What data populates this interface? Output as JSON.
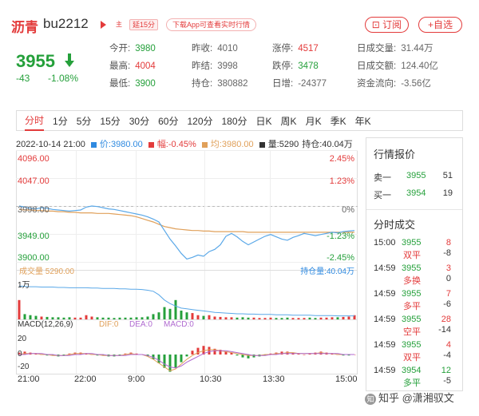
{
  "header": {
    "name": "沥青",
    "code": "bu2212",
    "tag_main": "主",
    "tag_delay": "延15分",
    "app_tag": "下载App可查看实时行情",
    "subscribe_label": "⊡ 订阅",
    "watch_label": "+自选"
  },
  "price": {
    "last": "3955",
    "change": "-43",
    "change_pct": "-1.08%",
    "direction": "down"
  },
  "quote": [
    {
      "k": "今开:",
      "v": "3980",
      "c": "green"
    },
    {
      "k": "昨收:",
      "v": "4010",
      "c": "gray"
    },
    {
      "k": "涨停:",
      "v": "4517",
      "c": "red"
    },
    {
      "k": "日成交量:",
      "v": "31.44万",
      "c": "gray"
    },
    {
      "k": "最高:",
      "v": "4004",
      "c": "red"
    },
    {
      "k": "昨结:",
      "v": "3998",
      "c": "gray"
    },
    {
      "k": "跌停:",
      "v": "3478",
      "c": "green"
    },
    {
      "k": "日成交额:",
      "v": "124.40亿",
      "c": "gray"
    },
    {
      "k": "最低:",
      "v": "3900",
      "c": "green"
    },
    {
      "k": "持仓:",
      "v": "380882",
      "c": "gray"
    },
    {
      "k": "日增:",
      "v": "-24377",
      "c": "gray"
    },
    {
      "k": "资金流向:",
      "v": "-3.56亿",
      "c": "gray"
    }
  ],
  "tabs": [
    "分时",
    "1分",
    "5分",
    "15分",
    "30分",
    "60分",
    "120分",
    "180分",
    "日K",
    "周K",
    "月K",
    "季K",
    "年K"
  ],
  "info_bar": {
    "datetime": "2022-10-14 21:00",
    "price": "价:3980.00",
    "amp": "幅:-0.45%",
    "avg": "均:3980.00",
    "vol": "量:5290",
    "oi": "持仓:40.04万"
  },
  "y_axis_left": [
    "4096.00",
    "4047.00",
    "3998.00",
    "3949.00",
    "3900.00"
  ],
  "y_axis_right": [
    "2.45%",
    "1.23%",
    "0%",
    "-1.23%",
    "-2.45%"
  ],
  "volume_legend": {
    "vol": "成交量 5290.00",
    "oi": "持仓量:40.04万",
    "unit": "1万"
  },
  "macd_legend": {
    "name": "MACD(12,26,9)",
    "dif": "DIF:0",
    "dea": "DEA:0",
    "macd": "MACD:0"
  },
  "macd_axis": [
    "20",
    "0",
    "-20"
  ],
  "x_axis": [
    "21:00",
    "22:00",
    "9:00",
    "10:30",
    "13:30",
    "15:00"
  ],
  "side": {
    "title": "行情报价",
    "orderbook": [
      {
        "k": "卖一",
        "p": "3955",
        "q": "51"
      },
      {
        "k": "买一",
        "p": "3954",
        "q": "19"
      }
    ],
    "trades_title": "分时成交",
    "trades": [
      {
        "t": "15:00",
        "p": "3955",
        "q": "8",
        "type": "双平",
        "d": "-8",
        "qc": "red",
        "tc": "red"
      },
      {
        "t": "14:59",
        "p": "3955",
        "q": "3",
        "type": "多换",
        "d": "0",
        "qc": "red",
        "tc": "red"
      },
      {
        "t": "14:59",
        "p": "3955",
        "q": "7",
        "type": "多平",
        "d": "-6",
        "qc": "red",
        "tc": "red"
      },
      {
        "t": "14:59",
        "p": "3955",
        "q": "28",
        "type": "空平",
        "d": "-14",
        "qc": "red",
        "tc": "red"
      },
      {
        "t": "14:59",
        "p": "3955",
        "q": "4",
        "type": "双平",
        "d": "-4",
        "qc": "red",
        "tc": "red"
      },
      {
        "t": "14:59",
        "p": "3954",
        "q": "12",
        "type": "多平",
        "d": "-5",
        "qc": "green",
        "tc": "green"
      }
    ]
  },
  "watermark": "知乎 @潇湘驭文",
  "colors": {
    "up": "#e33b3b",
    "down": "#25a03b",
    "price_line": "#5aa8e8",
    "avg_line": "#e0a05a",
    "accent": "#e33b3b"
  },
  "chart_data": {
    "type": "line",
    "price_range": [
      3900,
      4096
    ],
    "price_series": [
      3998,
      3996,
      3994,
      3993,
      3995,
      3994,
      3992,
      3991,
      3990,
      3989,
      3990,
      3991,
      3996,
      3998,
      3997,
      3995,
      3993,
      3992,
      3990,
      3988,
      3986,
      3984,
      3982,
      3979,
      3975,
      3970,
      3955,
      3940,
      3928,
      3915,
      3905,
      3908,
      3912,
      3910,
      3918,
      3922,
      3930,
      3945,
      3950,
      3944,
      3936,
      3930,
      3935,
      3940,
      3945,
      3948,
      3944,
      3940,
      3938,
      3943,
      3946,
      3950,
      3948,
      3946,
      3948,
      3950,
      3952,
      3951,
      3953,
      3954,
      3955
    ],
    "avg_series": [
      3992,
      3991,
      3991,
      3990,
      3990,
      3989,
      3989,
      3988,
      3988,
      3987,
      3987,
      3986,
      3986,
      3986,
      3985,
      3985,
      3985,
      3984,
      3983,
      3982,
      3981,
      3979,
      3976,
      3973,
      3970,
      3966,
      3962,
      3960,
      3958,
      3957,
      3956,
      3955,
      3955,
      3954,
      3954,
      3953,
      3953,
      3953,
      3953,
      3953,
      3953,
      3952,
      3952,
      3952,
      3952,
      3952,
      3952,
      3952,
      3952,
      3952,
      3952,
      3952,
      3952,
      3952,
      3952,
      3952,
      3952,
      3952,
      3952,
      3952,
      3952
    ],
    "volume_series": [
      0.55,
      0.15,
      0.12,
      0.1,
      0.08,
      0.07,
      0.06,
      0.06,
      0.05,
      0.06,
      0.05,
      0.05,
      0.12,
      0.08,
      0.06,
      0.05,
      0.05,
      0.04,
      0.05,
      0.05,
      0.05,
      0.06,
      0.06,
      0.08,
      0.15,
      0.2,
      0.35,
      0.3,
      0.55,
      0.25,
      0.2,
      0.18,
      0.12,
      0.1,
      0.12,
      0.08,
      0.07,
      0.06,
      0.06,
      0.05,
      0.06,
      0.05,
      0.05,
      0.04,
      0.04,
      0.05,
      0.04,
      0.04,
      0.05,
      0.04,
      0.04,
      0.04,
      0.05,
      0.04,
      0.05,
      0.05,
      0.06,
      0.06,
      0.07,
      0.08,
      0.12
    ],
    "oi_series": [
      0.95,
      0.94,
      0.93,
      0.93,
      0.92,
      0.92,
      0.92,
      0.91,
      0.91,
      0.9,
      0.9,
      0.9,
      0.9,
      0.89,
      0.89,
      0.88,
      0.88,
      0.88,
      0.87,
      0.87,
      0.86,
      0.86,
      0.85,
      0.83,
      0.8,
      0.7,
      0.55,
      0.45,
      0.38,
      0.32,
      0.3,
      0.28,
      0.26,
      0.24,
      0.22,
      0.2,
      0.19,
      0.18,
      0.17,
      0.16,
      0.16,
      0.15,
      0.15,
      0.14,
      0.14,
      0.14,
      0.13,
      0.13,
      0.13,
      0.12,
      0.12,
      0.12,
      0.12,
      0.11,
      0.11,
      0.11,
      0.11,
      0.1,
      0.1,
      0.1,
      0.1
    ],
    "macd_range": [
      -20,
      20
    ],
    "macd_hist": [
      2,
      3,
      2,
      1,
      0,
      -1,
      -1,
      -2,
      -1,
      1,
      2,
      2,
      1,
      0,
      -1,
      -1,
      -2,
      -2,
      -1,
      1,
      2,
      1,
      0,
      -2,
      -5,
      -9,
      -14,
      -18,
      -14,
      -8,
      -2,
      4,
      7,
      9,
      8,
      6,
      5,
      3,
      2,
      -1,
      -3,
      -4,
      -3,
      -2,
      -1,
      1,
      2,
      3,
      3,
      2,
      1,
      0,
      1,
      2,
      3,
      2,
      1,
      0,
      -1,
      -1,
      0
    ],
    "dif_series": [
      0,
      1,
      1,
      1,
      0,
      0,
      -1,
      -1,
      -1,
      0,
      1,
      1,
      1,
      0,
      0,
      -1,
      -1,
      -1,
      -1,
      0,
      1,
      0,
      0,
      -2,
      -5,
      -9,
      -13,
      -17,
      -15,
      -10,
      -5,
      -1,
      2,
      4,
      5,
      5,
      4,
      3,
      2,
      1,
      0,
      -1,
      -1,
      -1,
      0,
      0,
      1,
      1,
      2,
      2,
      1,
      1,
      1,
      1,
      2,
      1,
      1,
      0,
      0,
      0,
      0
    ],
    "dea_series": [
      0,
      0,
      1,
      1,
      1,
      0,
      0,
      -1,
      -1,
      -1,
      0,
      0,
      1,
      1,
      0,
      0,
      -1,
      -1,
      -1,
      -1,
      0,
      0,
      0,
      -1,
      -3,
      -6,
      -10,
      -13,
      -14,
      -12,
      -8,
      -5,
      -2,
      1,
      3,
      4,
      4,
      4,
      3,
      2,
      1,
      0,
      -1,
      -1,
      -1,
      0,
      0,
      1,
      1,
      1,
      1,
      1,
      1,
      1,
      1,
      1,
      1,
      1,
      0,
      0,
      0
    ]
  }
}
